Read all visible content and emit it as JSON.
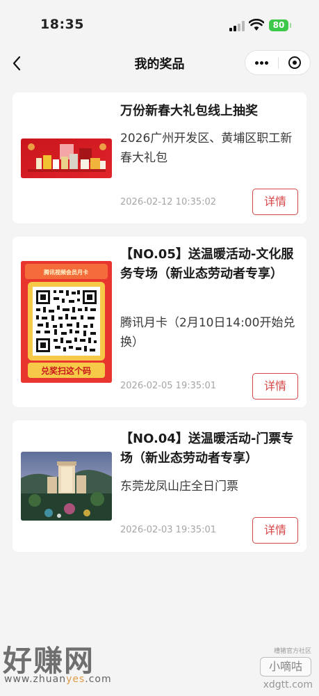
{
  "status_bar": {
    "time": "18:35",
    "battery": "80"
  },
  "nav": {
    "title": "我的奖品"
  },
  "prizes": [
    {
      "title": "万份新春大礼包线上抽奖",
      "description": "2026广州开发区、黄埔区职工新春大礼包",
      "date": "2026-02-12 10:35:02",
      "detail_label": "详情"
    },
    {
      "title": "【NO.05】送温暖活动-文化服务专场（新业态劳动者专享）",
      "description": "腾讯月卡（2月10日14:00开始兑换）",
      "date": "2026-02-05 19:35:01",
      "detail_label": "详情",
      "image": {
        "header": "腾讯视频会员月卡",
        "footer": "兑奖扫这个码"
      }
    },
    {
      "title": "【NO.04】送温暖活动-门票专场（新业态劳动者专享）",
      "description": "东莞龙凤山庄全日门票",
      "date": "2026-02-03 19:35:01",
      "detail_label": "详情"
    }
  ],
  "watermarks": {
    "left_big": "好赚网",
    "left_url_a": "www.zhuan",
    "left_url_b": "yes",
    "left_url_c": ".com",
    "right_small": "槽猪官方社区",
    "right_box": "小嘀咕",
    "right_domain": "xdgtt.com"
  },
  "colors": {
    "accent": "#d64545",
    "battery": "#3ec84a"
  }
}
